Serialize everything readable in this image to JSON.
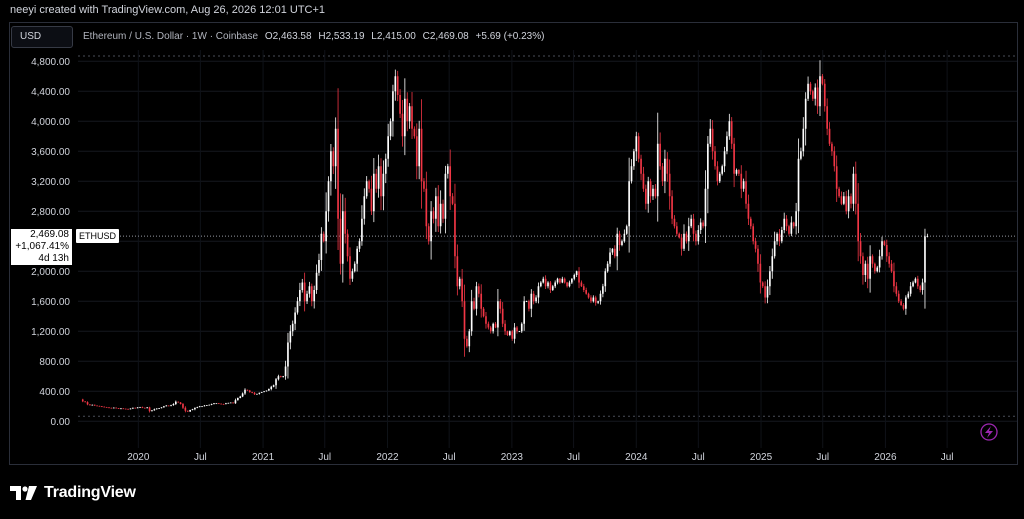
{
  "caption": "neeyi created with TradingView.com, Aug 26, 2026 12:01 UTC+1",
  "currency_button": "USD",
  "legend": {
    "symbol": "Ethereum / U.S. Dollar · 1W · Coinbase",
    "o_label": "O",
    "o_value": "2,463.58",
    "h_label": "H",
    "h_value": "2,533.19",
    "l_label": "L",
    "l_value": "2,415.00",
    "c_label": "C",
    "c_value": "2,469.08",
    "change": "+5.69 (+0.23%)"
  },
  "price_label": {
    "price": "2,469.08",
    "percent": "+1,067.41%",
    "countdown": "4d 13h",
    "symbol": "ETHUSD"
  },
  "footer": {
    "brand": "TradingView"
  },
  "colors": {
    "up": "#ffffff",
    "down": "#f23645",
    "grid": "#1e222d",
    "text": "#d1d4dc",
    "accent": "#9c27b0"
  },
  "icons": {
    "logo": "tradingview-logo-icon",
    "flash": "lightning-bolt-icon"
  },
  "chart_data": {
    "type": "candlestick",
    "interval": "weekly",
    "ylim": [
      -250,
      4950
    ],
    "y_ticks": [
      0,
      400,
      800,
      1200,
      1600,
      2000,
      2400,
      2800,
      3200,
      3600,
      4000,
      4400,
      4800
    ],
    "y_tick_labels": [
      "0.00",
      "400.00",
      "800.00",
      "1,200.00",
      "1,600.00",
      "2,000.00",
      "2,400.00",
      "2,800.00",
      "3,200.00",
      "3,600.00",
      "4,000.00",
      "4,400.00",
      "4,800.00"
    ],
    "x_ticks": [
      "2020",
      "Jul",
      "2021",
      "Jul",
      "2022",
      "Jul",
      "2023",
      "Jul",
      "2024",
      "Jul",
      "2025",
      "Jul",
      "2026",
      "Jul"
    ],
    "x_tick_dates": [
      "2020-01-01",
      "2020-07-01",
      "2021-01-01",
      "2021-07-01",
      "2022-01-01",
      "2022-07-01",
      "2023-01-01",
      "2023-07-01",
      "2024-01-01",
      "2024-07-01",
      "2025-01-01",
      "2025-07-01",
      "2026-01-01",
      "2026-07-01"
    ],
    "x_range": [
      "2019-07-08",
      "2026-10-26"
    ],
    "start_date": "2019-07-15",
    "last_close": 2469.08,
    "close": [
      290,
      265,
      255,
      225,
      215,
      220,
      210,
      205,
      200,
      195,
      190,
      185,
      180,
      178,
      182,
      175,
      170,
      172,
      168,
      165,
      160,
      170,
      180,
      175,
      185,
      190,
      180,
      175,
      185,
      135,
      145,
      160,
      170,
      175,
      185,
      200,
      210,
      205,
      215,
      230,
      260,
      250,
      230,
      180,
      140,
      130,
      150,
      160,
      180,
      190,
      200,
      200,
      210,
      215,
      220,
      230,
      240,
      240,
      235,
      230,
      228,
      240,
      245,
      250,
      240,
      280,
      310,
      330,
      370,
      420,
      410,
      390,
      380,
      360,
      365,
      380,
      390,
      400,
      410,
      430,
      460,
      480,
      560,
      600,
      590,
      600,
      730,
      1050,
      1200,
      1300,
      1450,
      1600,
      1750,
      1850,
      1600,
      1700,
      1800,
      1600,
      1750,
      1980,
      2150,
      2500,
      2400,
      2800,
      3200,
      3600,
      3400,
      3900,
      2700,
      2100,
      2800,
      2500,
      2200,
      1900,
      2000,
      2100,
      2300,
      2400,
      2700,
      3000,
      3200,
      3100,
      2800,
      3300,
      3100,
      3400,
      3000,
      3300,
      3500,
      3800,
      4000,
      4400,
      4600,
      4350,
      4100,
      3800,
      4300,
      4000,
      4200,
      3900,
      3800,
      3400,
      3900,
      3200,
      3100,
      2600,
      2400,
      2800,
      2700,
      3000,
      2600,
      2900,
      2700,
      3300,
      3400,
      3000,
      2900,
      2200,
      1800,
      1900,
      1600,
      1100,
      1000,
      1200,
      1600,
      1500,
      1800,
      1700,
      1500,
      1400,
      1300,
      1250,
      1200,
      1300,
      1250,
      1600,
      1500,
      1300,
      1200,
      1150,
      1200,
      1100,
      1250,
      1200,
      1200,
      1300,
      1600,
      1600,
      1500,
      1700,
      1600,
      1650,
      1800,
      1850,
      1900,
      1800,
      1850,
      1750,
      1800,
      1850,
      1900,
      1850,
      1900,
      1850,
      1800,
      1850,
      1900,
      1950,
      2000,
      1850,
      1800,
      1750,
      1700,
      1650,
      1600,
      1650,
      1580,
      1600,
      1700,
      1800,
      2000,
      2100,
      2250,
      2300,
      2200,
      2500,
      2350,
      2400,
      2500,
      2600,
      3200,
      3400,
      3600,
      3800,
      3500,
      3300,
      3100,
      2900,
      3200,
      3000,
      3100,
      3000,
      3700,
      3400,
      3200,
      3500,
      3300,
      3000,
      2700,
      2600,
      2500,
      2450,
      2300,
      2500,
      2400,
      2600,
      2700,
      2500,
      2400,
      2550,
      2650,
      2600,
      3100,
      3700,
      3900,
      3600,
      3400,
      3200,
      3300,
      3400,
      3600,
      3800,
      4000,
      3700,
      3300,
      3350,
      3300,
      3100,
      3200,
      2900,
      2700,
      2600,
      2400,
      2300,
      2100,
      1850,
      1800,
      1650,
      1800,
      2000,
      2200,
      2400,
      2500,
      2400,
      2550,
      2700,
      2600,
      2500,
      2650,
      2600,
      2800,
      3500,
      3600,
      3900,
      4300,
      4500,
      4400,
      4300,
      4450,
      4200,
      4600,
      4500,
      4200,
      3900,
      3700,
      3600,
      3400,
      3100,
      3000,
      2900,
      3000,
      2800,
      3000,
      2900,
      3300,
      2900,
      2400,
      2200,
      1950,
      2100,
      1900,
      2200,
      2100,
      2000,
      2050,
      2200,
      2400,
      2350,
      2200,
      2100,
      2000,
      1800,
      1700,
      1600,
      1550,
      1500,
      1650,
      1700,
      1800,
      1850,
      1900,
      1800,
      1750,
      1850,
      2463.58,
      2469.08
    ]
  }
}
